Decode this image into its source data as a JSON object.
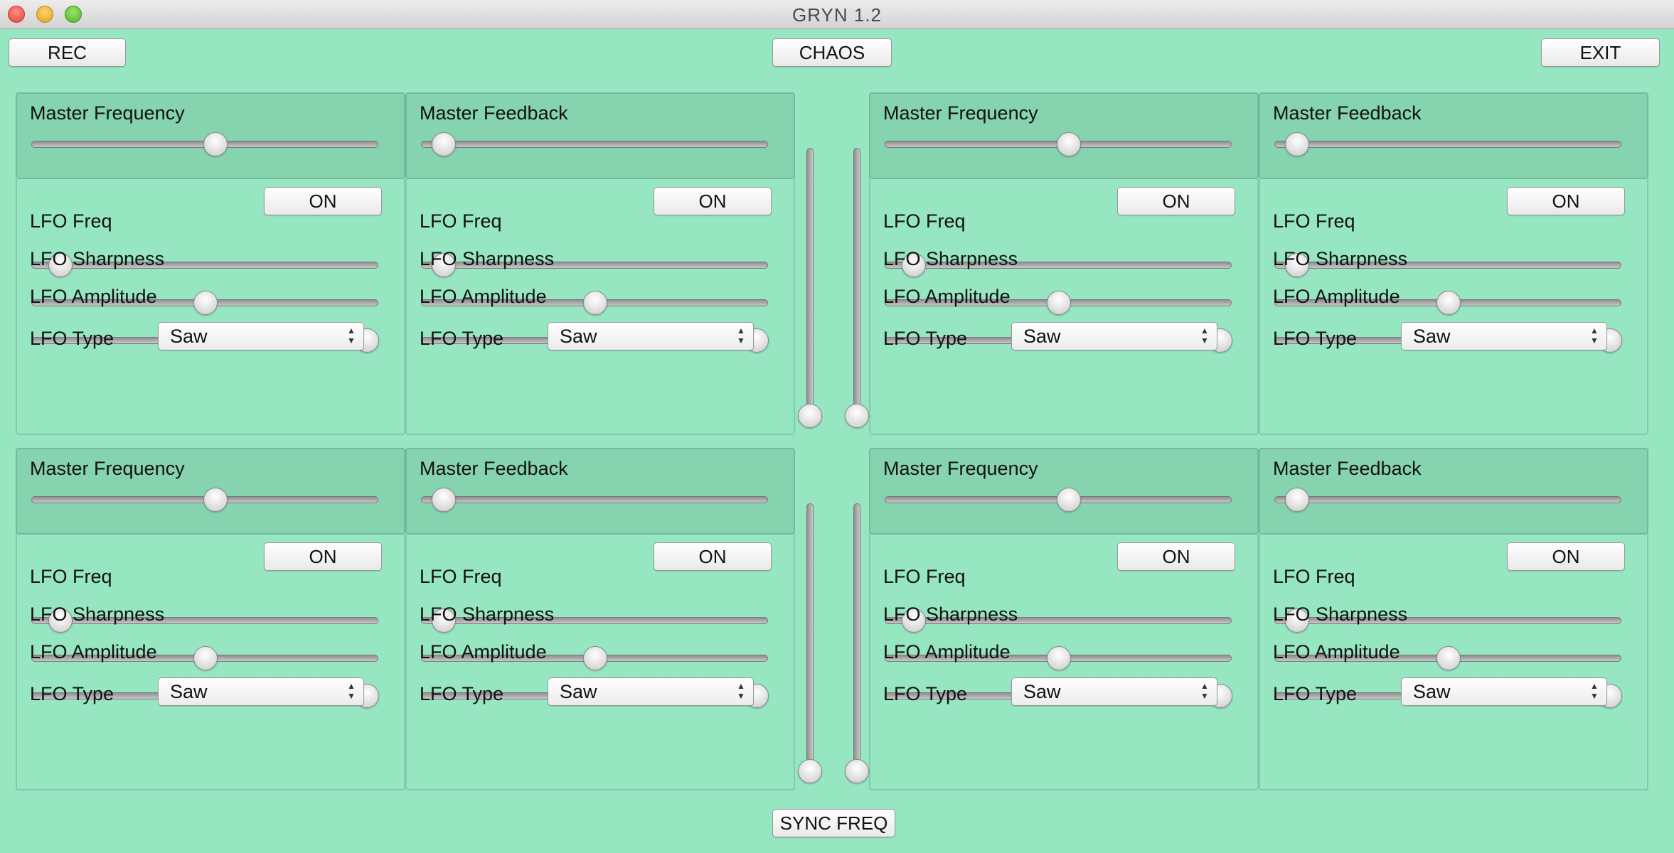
{
  "window": {
    "title": "GRYN 1.2"
  },
  "toolbar": {
    "rec_label": "REC",
    "chaos_label": "CHAOS",
    "exit_label": "EXIT"
  },
  "footer": {
    "sync_label": "SYNC FREQ"
  },
  "labels": {
    "master_frequency": "Master Frequency",
    "master_feedback": "Master Feedback",
    "lfo_freq": "LFO Freq",
    "lfo_sharpness": "LFO Sharpness",
    "lfo_amplitude": "LFO Amplitude",
    "lfo_type": "LFO Type",
    "on": "ON"
  },
  "modules": [
    {
      "id": "top-left-freq",
      "kind": "frequency",
      "master": 0.53,
      "lfo_on": "ON",
      "lfo_freq": 0.05,
      "lfo_sharpness": 0.5,
      "lfo_amplitude": 1.0,
      "lfo_type": "Saw"
    },
    {
      "id": "top-left-feedback",
      "kind": "feedback",
      "master": 0.03,
      "lfo_on": "ON",
      "lfo_freq": 0.03,
      "lfo_sharpness": 0.5,
      "lfo_amplitude": 1.0,
      "lfo_type": "Saw"
    },
    {
      "id": "top-right-freq",
      "kind": "frequency",
      "master": 0.53,
      "lfo_on": "ON",
      "lfo_freq": 0.05,
      "lfo_sharpness": 0.5,
      "lfo_amplitude": 1.0,
      "lfo_type": "Saw"
    },
    {
      "id": "top-right-feedback",
      "kind": "feedback",
      "master": 0.03,
      "lfo_on": "ON",
      "lfo_freq": 0.03,
      "lfo_sharpness": 0.5,
      "lfo_amplitude": 1.0,
      "lfo_type": "Saw"
    },
    {
      "id": "bottom-left-freq",
      "kind": "frequency",
      "master": 0.53,
      "lfo_on": "ON",
      "lfo_freq": 0.05,
      "lfo_sharpness": 0.5,
      "lfo_amplitude": 1.0,
      "lfo_type": "Saw"
    },
    {
      "id": "bottom-left-feedback",
      "kind": "feedback",
      "master": 0.03,
      "lfo_on": "ON",
      "lfo_freq": 0.03,
      "lfo_sharpness": 0.5,
      "lfo_amplitude": 1.0,
      "lfo_type": "Saw"
    },
    {
      "id": "bottom-right-freq",
      "kind": "frequency",
      "master": 0.53,
      "lfo_on": "ON",
      "lfo_freq": 0.05,
      "lfo_sharpness": 0.5,
      "lfo_amplitude": 1.0,
      "lfo_type": "Saw"
    },
    {
      "id": "bottom-right-feedback",
      "kind": "feedback",
      "master": 0.03,
      "lfo_on": "ON",
      "lfo_freq": 0.03,
      "lfo_sharpness": 0.5,
      "lfo_amplitude": 1.0,
      "lfo_type": "Saw"
    }
  ],
  "vertical_sliders": [
    {
      "id": "top-vslider-1",
      "value": 0.0
    },
    {
      "id": "top-vslider-2",
      "value": 0.0
    },
    {
      "id": "bottom-vslider-1",
      "value": 0.0
    },
    {
      "id": "bottom-vslider-2",
      "value": 0.0
    }
  ],
  "colors": {
    "background": "#96e6c2",
    "master_panel": "#86d3b0"
  }
}
